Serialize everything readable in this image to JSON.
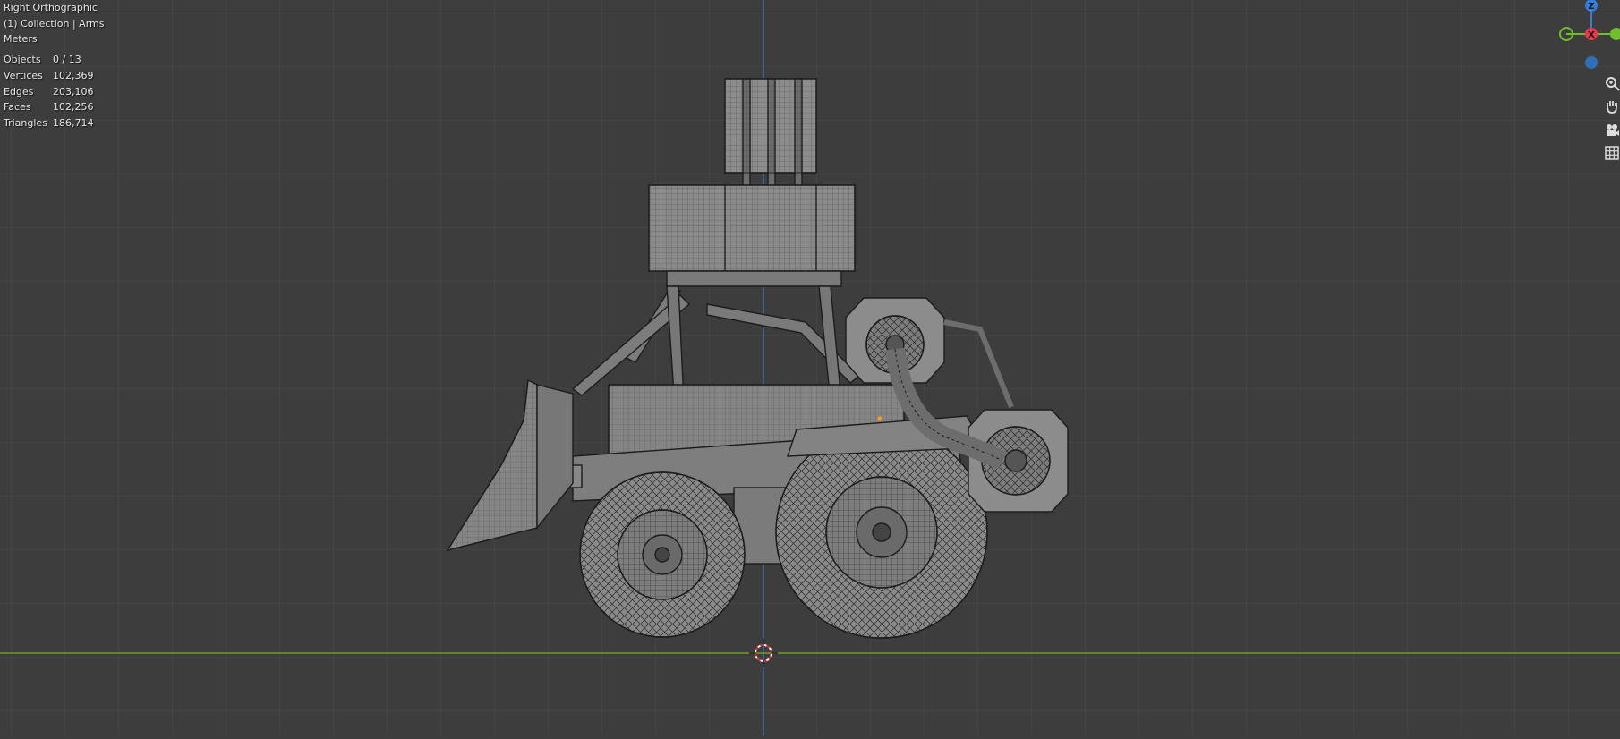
{
  "viewport": {
    "view_name": "Right Orthographic",
    "collection_info": "(1) Collection | Arms",
    "units": "Meters"
  },
  "stats": [
    {
      "label": "Objects",
      "value": "0 / 13"
    },
    {
      "label": "Vertices",
      "value": "102,369"
    },
    {
      "label": "Edges",
      "value": "203,106"
    },
    {
      "label": "Faces",
      "value": "102,256"
    },
    {
      "label": "Triangles",
      "value": "186,714"
    }
  ],
  "gizmo": {
    "z_label": "Z",
    "x_label": "X",
    "x_color": "#f2334f",
    "y_color": "#6fbf2a",
    "z_color": "#2f7fdc"
  },
  "navigation": {
    "zoom_icon": "zoom-icon",
    "pan_icon": "hand-icon",
    "camera_icon": "camera-icon",
    "grid_icon": "grid-icon"
  },
  "colors": {
    "background": "#3d3d3d",
    "grid_line": "#4a4a4a",
    "axis_y": "#7ab02a",
    "axis_z": "#3a78b8",
    "mesh_fill": "#8a8a8a",
    "wire": "#1a1a1a"
  }
}
